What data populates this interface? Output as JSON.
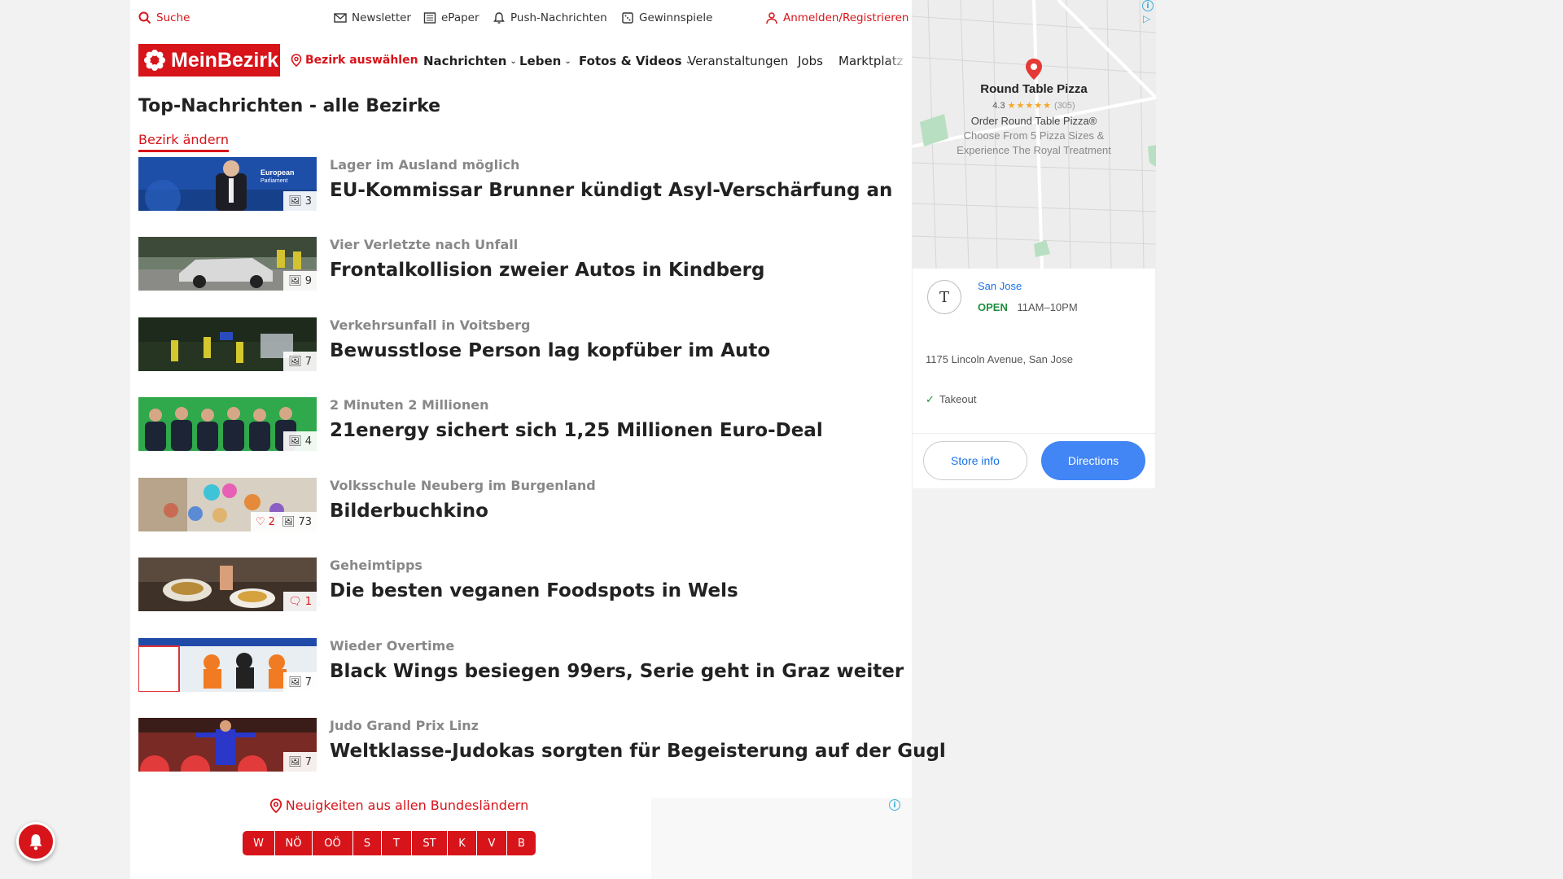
{
  "topbar": {
    "search": "Suche",
    "newsletter": "Newsletter",
    "epaper": "ePaper",
    "push": "Push-Nachrichten",
    "gewinnspiele": "Gewinnspiele",
    "login": "Anmelden/Registrieren"
  },
  "navbar": {
    "logo": "MeinBezirk",
    "bezirk": "Bezirk auswählen",
    "items": [
      "Nachrichten",
      "Leben",
      "Fotos & Videos",
      "Veranstaltungen",
      "Jobs",
      "Marktplatz"
    ]
  },
  "main": {
    "title": "Top-Nachrichten - alle Bezirke",
    "change_link": "Bezirk ändern"
  },
  "articles": [
    {
      "kicker": "Lager im Ausland möglich",
      "headline": "EU-Kommissar Brunner kündigt Asyl-Verschärfung an",
      "photos": "3"
    },
    {
      "kicker": "Vier Verletzte nach Unfall",
      "headline": "Frontalkollision zweier Autos in Kindberg",
      "photos": "9"
    },
    {
      "kicker": "Verkehrsunfall in Voitsberg",
      "headline": "Bewusstlose Person lag kopfüber im Auto",
      "photos": "7"
    },
    {
      "kicker": "2 Minuten 2 Millionen",
      "headline": "21energy sichert sich 1,25 Millionen Euro-Deal",
      "photos": "4"
    },
    {
      "kicker": "Volksschule Neuberg im Burgenland",
      "headline": "Bilderbuchkino",
      "likes": "2",
      "photos": "73"
    },
    {
      "kicker": "Geheimtipps",
      "headline": "Die besten veganen Foodspots in Wels",
      "comments": "1"
    },
    {
      "kicker": "Wieder Overtime",
      "headline": "Black Wings besiegen 99ers, Serie geht in Graz weiter",
      "photos": "7"
    },
    {
      "kicker": "Judo Grand Prix Linz",
      "headline": "Weltklasse-Judokas sorgten für Begeisterung auf der Gugl",
      "photos": "7"
    }
  ],
  "bundeslaender": {
    "title": "Neuigkeiten aus allen Bundesländern",
    "states": [
      "W",
      "NÖ",
      "OÖ",
      "S",
      "T",
      "ST",
      "K",
      "V",
      "B"
    ]
  },
  "ad": {
    "map_title": "Round Table Pizza",
    "rating": "4.3",
    "reviews": "(305)",
    "line1": "Order Round Table Pizza®",
    "line2": "Choose From 5 Pizza Sizes &",
    "line3": "Experience The Royal Treatment",
    "city": "San Jose",
    "open": "OPEN",
    "hours": "11AM–10PM",
    "address": "1175 Lincoln Avenue, San Jose",
    "takeout": "Takeout",
    "store_info": "Store info",
    "directions": "Directions"
  },
  "colors": {
    "brand": "#d7141a",
    "link_blue": "#1a73e8",
    "button_blue": "#4285f4",
    "open_green": "#1e8e3e"
  }
}
